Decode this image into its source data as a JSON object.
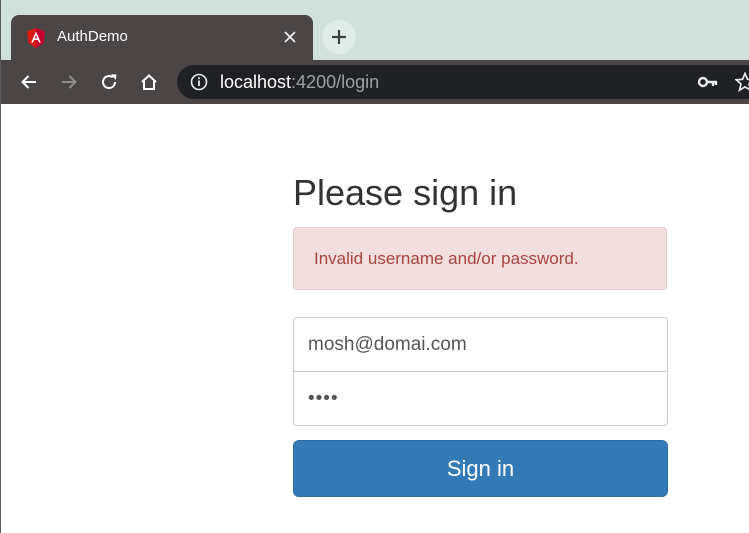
{
  "browser": {
    "tab": {
      "title": "AuthDemo",
      "favicon": "angular-icon"
    },
    "new_tab_icon": "plus-icon",
    "toolbar": {
      "back_icon": "back-arrow-icon",
      "forward_icon": "forward-arrow-icon",
      "reload_icon": "reload-icon",
      "home_icon": "home-icon"
    },
    "address_bar": {
      "host": "localhost",
      "rest": ":4200/login",
      "info_icon": "info-icon",
      "key_icon": "key-icon",
      "bookmark_icon": "star-icon"
    }
  },
  "login": {
    "title": "Please sign in",
    "error": "Invalid username and/or password.",
    "email_value": "mosh@domai.com",
    "password_value": "••••",
    "submit_label": "Sign in"
  },
  "colors": {
    "chrome_dark": "#4b4545",
    "tabstrip": "#cfe1da",
    "omnibox": "#202124",
    "alert_bg": "#f2dede",
    "alert_text": "#a94442",
    "primary": "#337ab7"
  }
}
